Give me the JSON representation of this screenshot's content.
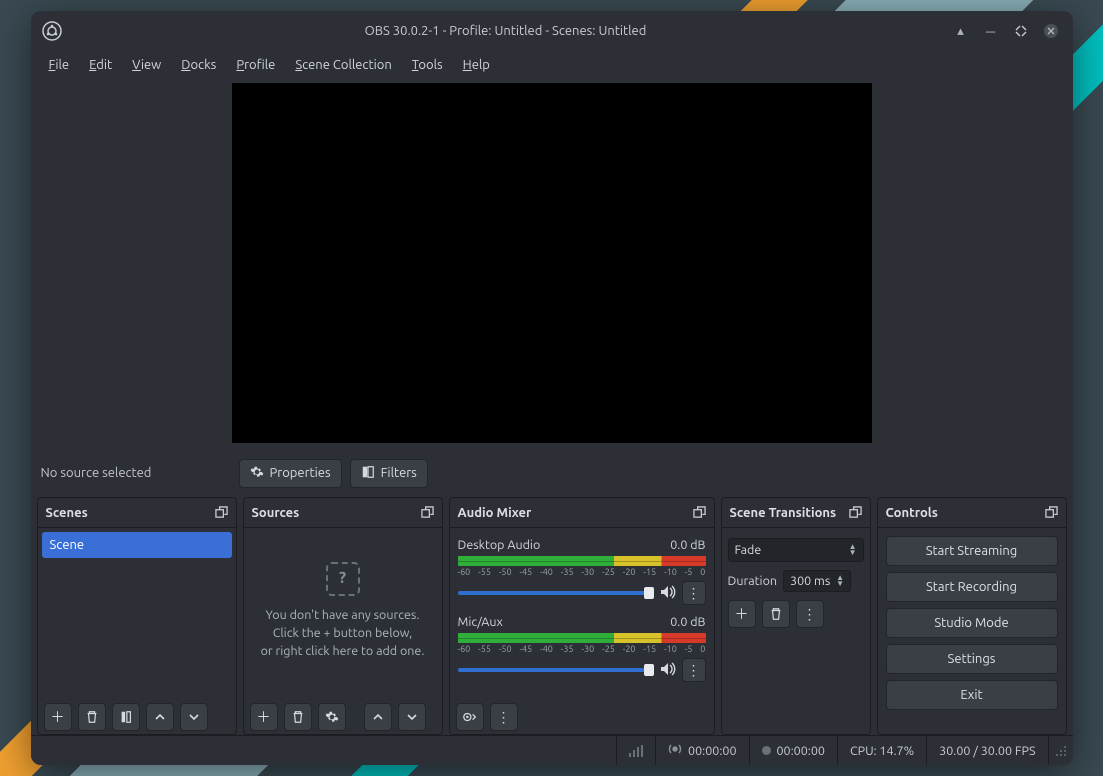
{
  "title": "OBS 30.0.2-1 - Profile: Untitled - Scenes: Untitled",
  "menu": [
    "File",
    "Edit",
    "View",
    "Docks",
    "Profile",
    "Scene Collection",
    "Tools",
    "Help"
  ],
  "srcbar": {
    "label": "No source selected",
    "properties": "Properties",
    "filters": "Filters"
  },
  "panels": {
    "scenes": {
      "title": "Scenes",
      "items": [
        "Scene"
      ]
    },
    "sources": {
      "title": "Sources",
      "empty1": "You don't have any sources.",
      "empty2": "Click the + button below,",
      "empty3": "or right click here to add one."
    },
    "mixer": {
      "title": "Audio Mixer",
      "ticks": [
        "-60",
        "-55",
        "-50",
        "-45",
        "-40",
        "-35",
        "-30",
        "-25",
        "-20",
        "-15",
        "-10",
        "-5",
        "0"
      ],
      "channels": [
        {
          "name": "Desktop Audio",
          "db": "0.0 dB"
        },
        {
          "name": "Mic/Aux",
          "db": "0.0 dB"
        }
      ]
    },
    "transitions": {
      "title": "Scene Transitions",
      "selected": "Fade",
      "durationLabel": "Duration",
      "durationValue": "300 ms"
    },
    "controls": {
      "title": "Controls",
      "buttons": [
        "Start Streaming",
        "Start Recording",
        "Studio Mode",
        "Settings",
        "Exit"
      ]
    }
  },
  "status": {
    "liveTime": "00:00:00",
    "recTime": "00:00:00",
    "cpu": "CPU: 14.7%",
    "fps": "30.00 / 30.00 FPS"
  }
}
